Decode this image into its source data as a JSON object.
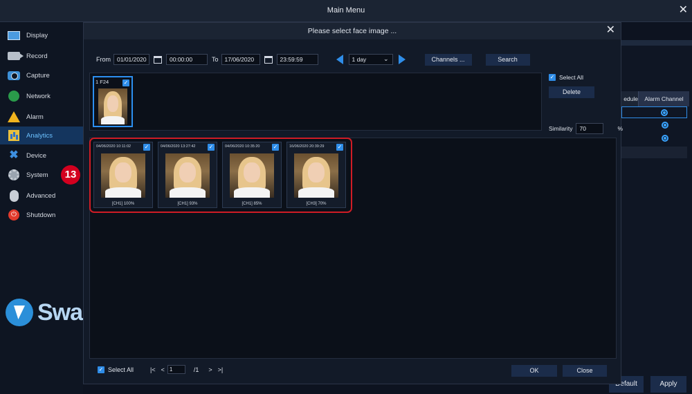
{
  "window": {
    "title": "Main Menu",
    "close": "✕"
  },
  "sidebar": {
    "items": [
      {
        "label": "Display"
      },
      {
        "label": "Record"
      },
      {
        "label": "Capture"
      },
      {
        "label": "Network"
      },
      {
        "label": "Alarm"
      },
      {
        "label": "Analytics"
      },
      {
        "label": "Device"
      },
      {
        "label": "System"
      },
      {
        "label": "Advanced"
      },
      {
        "label": "Shutdown"
      }
    ],
    "active": "Analytics",
    "logo_text": "Swa",
    "step_badge": "13"
  },
  "background_panel": {
    "col_partial": "edule",
    "col_alarm": "Alarm Channel",
    "default_button": "Default",
    "apply_button": "Apply"
  },
  "dialog": {
    "title": "Please select face image ...",
    "close": "✕",
    "filter": {
      "from_label": "From",
      "from_date": "01/01/2020",
      "from_time": "00:00:00",
      "to_label": "To",
      "to_date": "17/06/2020",
      "to_time": "23:59:59",
      "span": "1 day",
      "channels_button": "Channels ...",
      "search_button": "Search"
    },
    "query": {
      "label": "1  F24",
      "select_all": "Select All",
      "delete_button": "Delete",
      "similarity_label": "Similarity",
      "similarity_value": "70",
      "similarity_unit": "%"
    },
    "results": [
      {
        "time": "04/06/2020 10:11:02",
        "caption": "[CH1] 100%"
      },
      {
        "time": "04/06/2020 13:27:42",
        "caption": "[CH1] 93%"
      },
      {
        "time": "04/06/2020 10:35:20",
        "caption": "[CH1] 85%"
      },
      {
        "time": "16/06/2020 20:39:29",
        "caption": "[CH3] 70%"
      }
    ],
    "footer": {
      "select_all": "Select All",
      "first": "|<",
      "prev": "<",
      "page": "1",
      "total": "/1",
      "next": ">",
      "last": ">|",
      "ok_button": "OK",
      "close_button": "Close"
    }
  },
  "colors": {
    "accent": "#2f8de8",
    "highlight": "#d01c25",
    "badge": "#d3001f"
  }
}
